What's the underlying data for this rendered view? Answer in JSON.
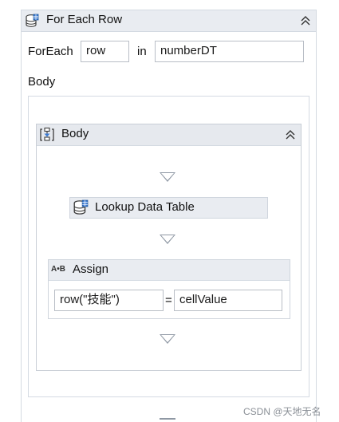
{
  "foreach": {
    "title": "For Each Row",
    "foreach_label": "ForEach",
    "item_variable": "row",
    "in_label": "in",
    "collection": "numberDT",
    "body_label": "Body"
  },
  "sequence": {
    "title": "Body"
  },
  "lookup": {
    "title": "Lookup Data Table"
  },
  "assign": {
    "icon_text": "A•B",
    "title": "Assign",
    "left_value": "row(\"技能\")",
    "equals": "=",
    "right_value": "cellValue"
  },
  "watermark": "CSDN @天地无名",
  "colors": {
    "header_bg": "#e9ecf1",
    "border": "#d4dae2",
    "drop_arrow": "#8f98a4"
  }
}
